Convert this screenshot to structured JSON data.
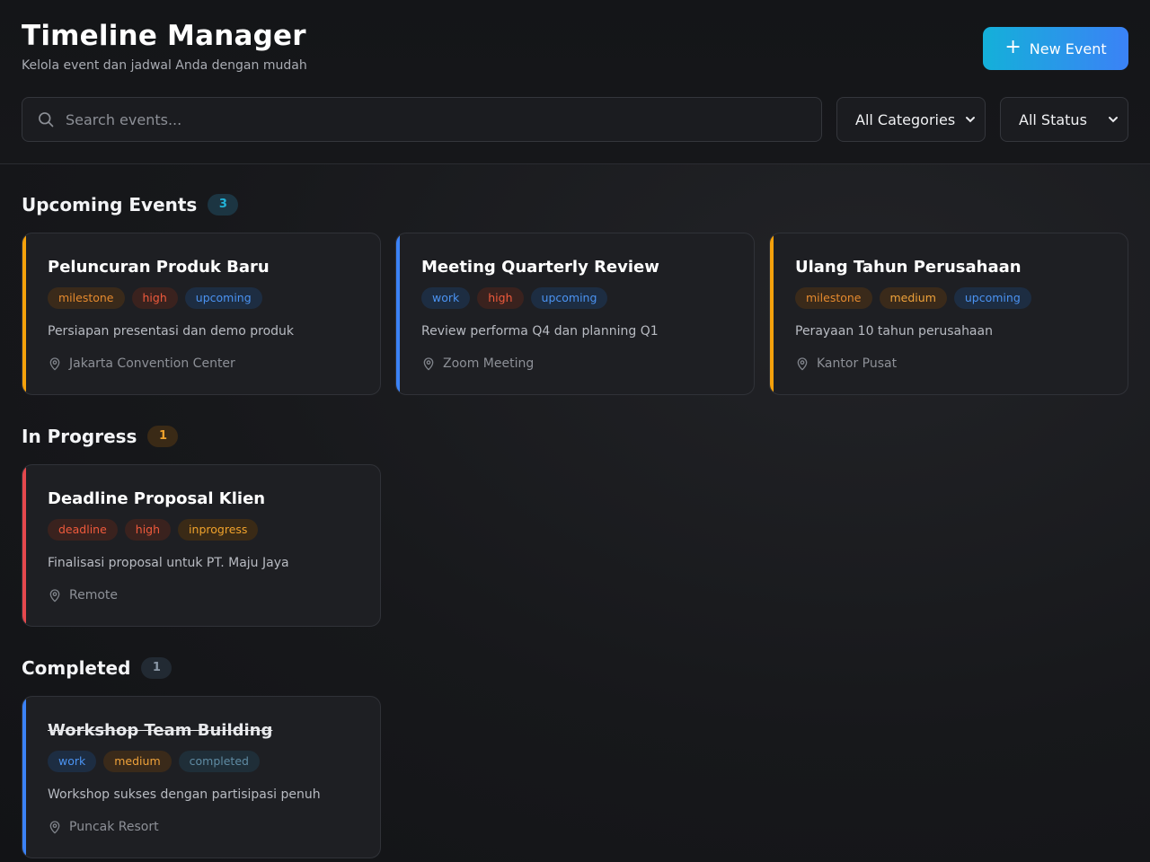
{
  "app": {
    "title": "Timeline Manager",
    "subtitle": "Kelola event dan jadwal Anda dengan mudah",
    "new_button": "New Event"
  },
  "search": {
    "placeholder": "Search events...",
    "value": ""
  },
  "filters": {
    "category": "All Categories",
    "status": "All Status"
  },
  "colors": {
    "milestone": "#f59e0b",
    "work": "#3b82f6",
    "deadline": "#ef4444",
    "high": "#ef5a3c",
    "medium": "#f59e0b",
    "upcoming": "#3b8ff5",
    "inprogress": "#f59e0b",
    "completed": "#6a8aa0"
  },
  "sections": [
    {
      "title": "Upcoming Events",
      "count": "3",
      "key": "upcoming",
      "events": [
        {
          "title": "Peluncuran Produk Baru",
          "category": "milestone",
          "priority": "high",
          "status": "upcoming",
          "description": "Persiapan presentasi dan demo produk",
          "location": "Jakarta Convention Center"
        },
        {
          "title": "Meeting Quarterly Review",
          "category": "work",
          "priority": "high",
          "status": "upcoming",
          "description": "Review performa Q4 dan planning Q1",
          "location": "Zoom Meeting"
        },
        {
          "title": "Ulang Tahun Perusahaan",
          "category": "milestone",
          "priority": "medium",
          "status": "upcoming",
          "description": "Perayaan 10 tahun perusahaan",
          "location": "Kantor Pusat"
        }
      ]
    },
    {
      "title": "In Progress",
      "count": "1",
      "key": "progress",
      "events": [
        {
          "title": "Deadline Proposal Klien",
          "category": "deadline",
          "priority": "high",
          "status": "inprogress",
          "description": "Finalisasi proposal untuk PT. Maju Jaya",
          "location": "Remote"
        }
      ]
    },
    {
      "title": "Completed",
      "count": "1",
      "key": "completed",
      "events": [
        {
          "title": "Workshop Team Building",
          "category": "work",
          "priority": "medium",
          "status": "completed",
          "description": "Workshop sukses dengan partisipasi penuh",
          "location": "Puncak Resort"
        }
      ]
    }
  ]
}
